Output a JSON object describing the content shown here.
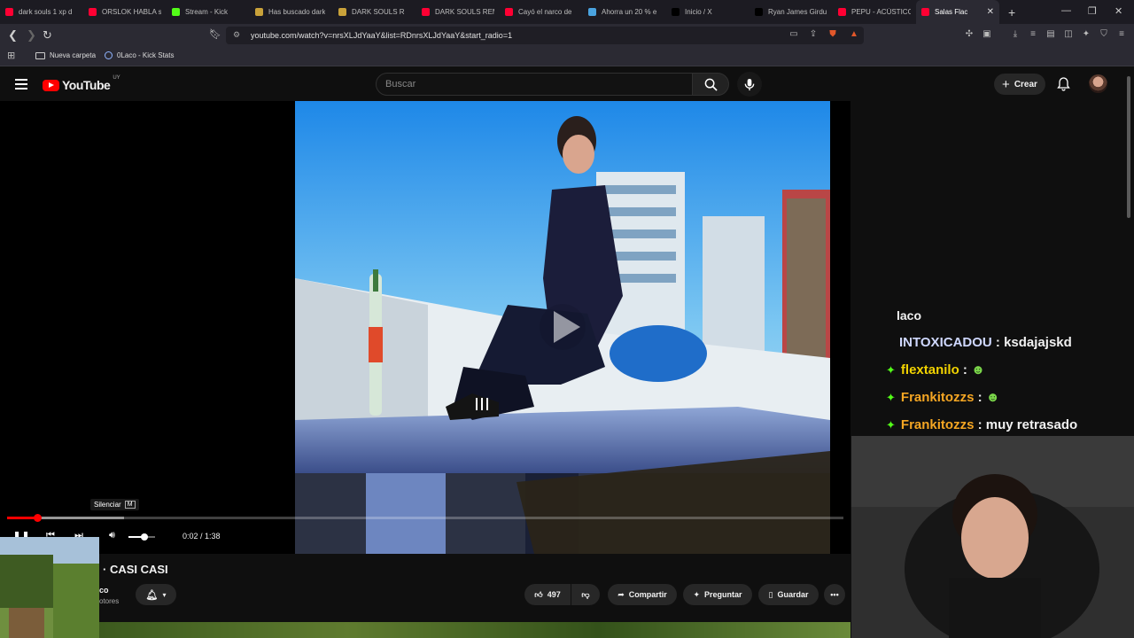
{
  "tabs": [
    {
      "label": "dark souls 1 xp d",
      "color": "#ff0033"
    },
    {
      "label": "ORSLOK HABLA s",
      "color": "#ff0033"
    },
    {
      "label": "Stream - Kick",
      "color": "#53fc18"
    },
    {
      "label": "Has buscado dark",
      "color": "#c9a23a"
    },
    {
      "label": "DARK SOULS R",
      "color": "#c9a23a"
    },
    {
      "label": "DARK SOULS REM",
      "color": "#ff0033"
    },
    {
      "label": "Cayó el narco de",
      "color": "#ff0033"
    },
    {
      "label": "Ahorra un 20 % e",
      "color": "#4aa3df"
    },
    {
      "label": "Inicio / X",
      "color": "#000000"
    },
    {
      "label": "Ryan James Girdu",
      "color": "#000000"
    },
    {
      "label": "PEPU - ACÚSTICO",
      "color": "#ff0033"
    },
    {
      "label": "Salas Flac",
      "color": "#ff0033",
      "active": true
    }
  ],
  "address": {
    "url": "youtube.com/watch?v=nrsXLJdYaaY&list=RDnrsXLJdYaaY&start_radio=1"
  },
  "bookmarks": [
    {
      "label": "Nueva carpeta"
    },
    {
      "label": "0Laco - Kick Stats"
    }
  ],
  "youtube": {
    "logo": "YouTube",
    "region": "UY",
    "search_placeholder": "Buscar",
    "create_label": "Crear"
  },
  "player": {
    "tooltip": "Silenciar",
    "tooltip_key": "M",
    "time": "0:02 / 1:38",
    "progress_played": 0.036,
    "progress_buffered": 0.14,
    "volume_level": 0.6
  },
  "video": {
    "title_fragment": "· CASI CASI",
    "channel_fragment": "co",
    "subs_fragment": "otores",
    "likes": "497",
    "share_label": "Compartir",
    "ask_label": "Preguntar",
    "save_label": "Guardar"
  },
  "chat": {
    "header": "laco",
    "messages": [
      {
        "user": "INTOXICADOU",
        "text": "ksdajajskd",
        "star": false,
        "color": "#cfd8ff"
      },
      {
        "user": "flextanilo",
        "text": "",
        "star": true,
        "color": "#f2d300",
        "emote": true
      },
      {
        "user": "Frankitozzs",
        "text": "",
        "star": true,
        "color": "#f5a623",
        "emote": true
      },
      {
        "user": "Frankitozzs",
        "text": "muy retrasado",
        "star": true,
        "color": "#f5a623"
      }
    ]
  }
}
